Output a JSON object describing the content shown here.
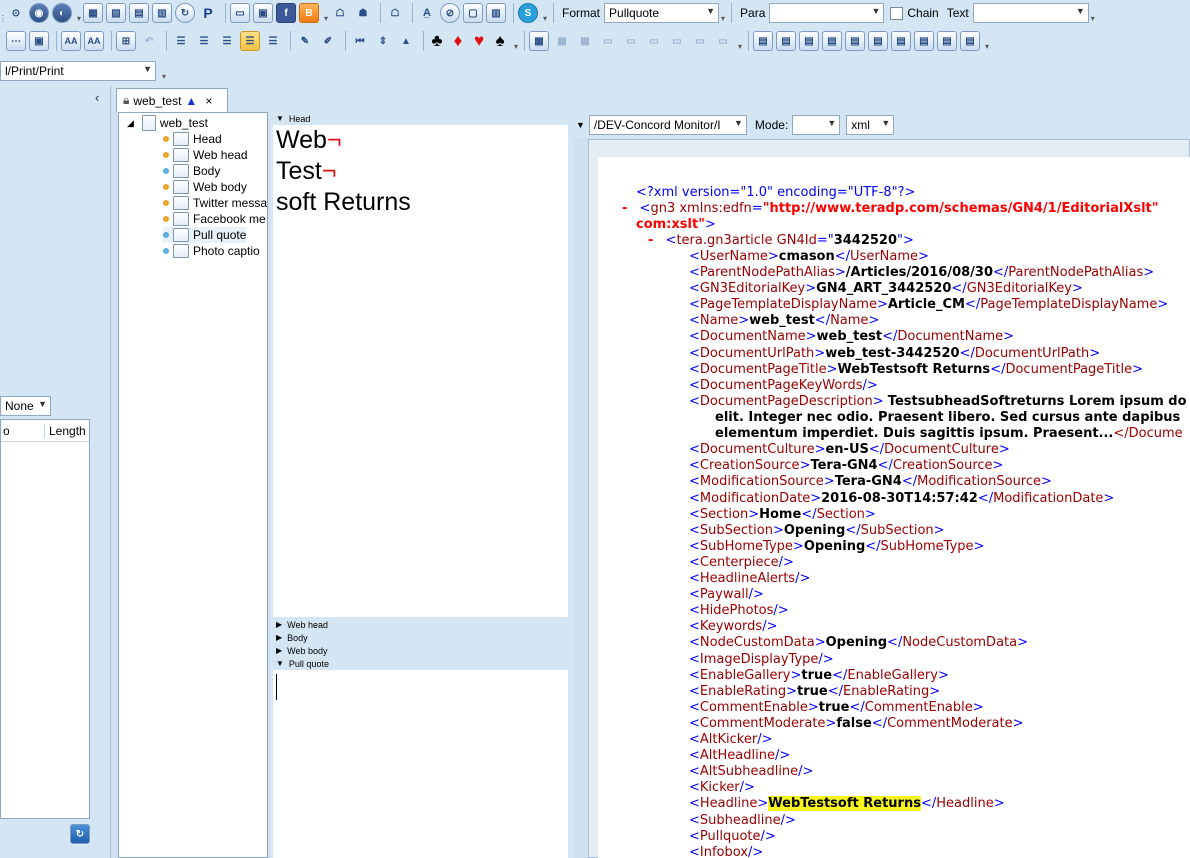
{
  "toolbar": {
    "format_label": "Format",
    "format_value": "Pullquote",
    "para_label": "Para",
    "para_value": "",
    "chain_label": "Chain",
    "chain_checked": false,
    "text_label": "Text",
    "text_value": "",
    "row1_icons": [
      "binoculars-icon",
      "globe-icon",
      "globe-search-icon",
      "images-icon",
      "image-edit-icon",
      "document-icon",
      "document-pdf-icon",
      "refresh-document-icon",
      "p-icon",
      "screen-icon",
      "window-icon",
      "facebook-icon",
      "blogger-icon",
      "user-move-icon",
      "user-swap-icon",
      "user-upload-icon",
      "spell-check-icon",
      "compass-icon",
      "frame-icon",
      "columns-icon",
      "skype-icon"
    ],
    "row2_icons": [
      "dots-icon",
      "save-icon",
      "font-size-up-icon",
      "font-size-down-icon",
      "table-insert-icon",
      "undo-icon",
      "align-left-icon",
      "align-center-icon",
      "align-right-icon",
      "justify-icon",
      "align-justify-all-icon",
      "pipette-icon",
      "marker-icon",
      "first-page-icon",
      "line-spacing-icon",
      "collapse-icon"
    ],
    "suits": [
      "♣",
      "♦",
      "♥",
      "♠"
    ],
    "row2_grid_icons": [
      "grid-icon",
      "grid-disabled-1-icon",
      "grid-disabled-2-icon",
      "grid-disabled-3-icon",
      "grid-disabled-4-icon",
      "grid-disabled-5-icon",
      "grid-disabled-6-icon",
      "grid-disabled-7-icon",
      "grid-disabled-8-icon"
    ],
    "row2_layout_icons": [
      "layout-1-icon",
      "layout-2-icon",
      "layout-3-icon",
      "layout-4-icon",
      "layout-5-icon",
      "layout-6-icon",
      "layout-7-icon",
      "layout-8-icon",
      "layout-9-icon",
      "layout-10-icon"
    ],
    "path_value": "l/Print/Print"
  },
  "left_pane": {
    "filter_value": "None",
    "grid_col1": "o",
    "grid_col2": "Length"
  },
  "tab": {
    "label": "web_test",
    "close": "×"
  },
  "tree": {
    "root": "web_test",
    "items": [
      {
        "label": "Head",
        "dot": "#f0a030"
      },
      {
        "label": "Web head",
        "dot": "#f0a030"
      },
      {
        "label": "Body",
        "dot": "#5ab0e0"
      },
      {
        "label": "Web body",
        "dot": "#f0a030"
      },
      {
        "label": "Twitter messa",
        "dot": "#f0a030"
      },
      {
        "label": "Facebook me",
        "dot": "#f0a030"
      },
      {
        "label": "Pull quote",
        "dot": "#5ab0e0"
      },
      {
        "label": "Photo captio",
        "dot": "#5ab0e0"
      }
    ]
  },
  "editor": {
    "head_label": "Head",
    "head_lines": [
      "Web",
      "Test",
      "soft Returns"
    ],
    "pilcrow": "¬",
    "collapsed_sections": [
      "Web head",
      "Body",
      "Web body"
    ],
    "pull_quote_label": "Pull quote"
  },
  "xml_bar": {
    "path_value": "/DEV-Concord Monitor/I",
    "mode_label": "Mode:",
    "mode_value": "",
    "format_value": "xml"
  },
  "xml": {
    "decl": "<?xml version=\"1.0\" encoding=\"UTF-8\"?>",
    "gn3_open": "gn3",
    "gn3_attr": "xmlns:edfn",
    "gn3_url": "http://www.teradp.com/schemas/GN4/1/EditorialXslt",
    "gn3_url2": "com:xslt",
    "article_tag": "tera.gn3article",
    "article_attr": "GN4Id",
    "article_id": "3442520",
    "elements": [
      {
        "name": "UserName",
        "value": "cmason"
      },
      {
        "name": "ParentNodePathAlias",
        "value": "/Articles/2016/08/30"
      },
      {
        "name": "GN3EditorialKey",
        "value": "GN4_ART_3442520"
      },
      {
        "name": "PageTemplateDisplayName",
        "value": "Article_CM"
      },
      {
        "name": "Name",
        "value": "web_test"
      },
      {
        "name": "DocumentName",
        "value": "web_test"
      },
      {
        "name": "DocumentUrlPath",
        "value": "web_test-3442520"
      },
      {
        "name": "DocumentPageTitle",
        "value": "WebTestsoft Returns"
      },
      {
        "name": "DocumentPageKeyWords",
        "value": null
      }
    ],
    "description_name": "DocumentPageDescription",
    "description_lines": [
      "TestsubheadSoftreturns Lorem ipsum do",
      "elit. Integer nec odio. Praesent libero. Sed cursus ante dapibus",
      "elementum imperdiet. Duis sagittis ipsum. Praesent..."
    ],
    "description_close": "</Docume",
    "elements2": [
      {
        "name": "DocumentCulture",
        "value": "en-US"
      },
      {
        "name": "CreationSource",
        "value": "Tera-GN4"
      },
      {
        "name": "ModificationSource",
        "value": "Tera-GN4"
      },
      {
        "name": "ModificationDate",
        "value": "2016-08-30T14:57:42"
      },
      {
        "name": "Section",
        "value": "Home"
      },
      {
        "name": "SubSection",
        "value": "Opening"
      },
      {
        "name": "SubHomeType",
        "value": "Opening"
      },
      {
        "name": "Centerpiece",
        "value": null
      },
      {
        "name": "HeadlineAlerts",
        "value": null
      },
      {
        "name": "Paywall",
        "value": null
      },
      {
        "name": "HidePhotos",
        "value": null
      },
      {
        "name": "Keywords",
        "value": null
      },
      {
        "name": "NodeCustomData",
        "value": "Opening"
      },
      {
        "name": "ImageDisplayType",
        "value": null
      },
      {
        "name": "EnableGallery",
        "value": "true"
      },
      {
        "name": "EnableRating",
        "value": "true"
      },
      {
        "name": "CommentEnable",
        "value": "true"
      },
      {
        "name": "CommentModerate",
        "value": "false"
      },
      {
        "name": "AltKicker",
        "value": null
      },
      {
        "name": "AltHeadline",
        "value": null
      },
      {
        "name": "AltSubheadline",
        "value": null
      },
      {
        "name": "Kicker",
        "value": null
      },
      {
        "name": "Headline",
        "value": "WebTestsoft Returns",
        "highlight": true
      },
      {
        "name": "Subheadline",
        "value": null
      },
      {
        "name": "Pullquote",
        "value": null
      },
      {
        "name": "Infobox",
        "value": null
      }
    ],
    "highlight_color": "#f7f51f"
  }
}
